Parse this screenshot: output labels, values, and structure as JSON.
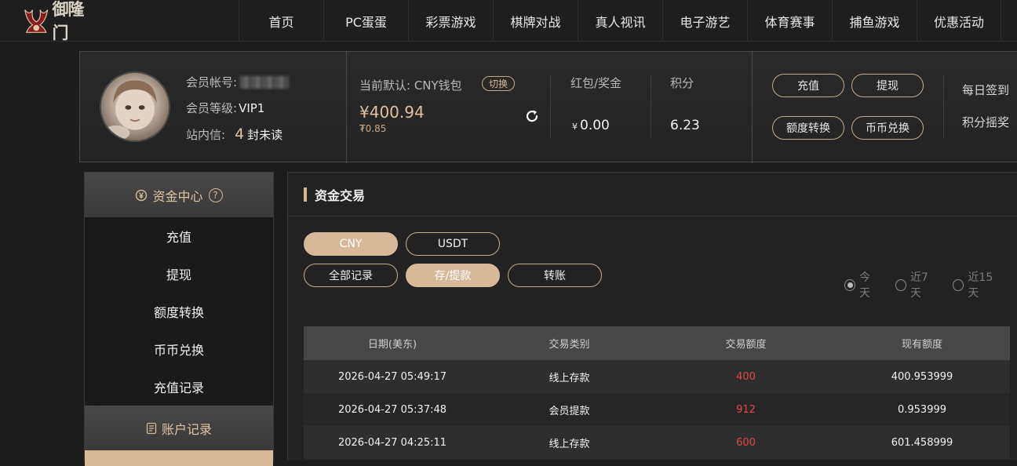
{
  "brand": {
    "name": "御隆门"
  },
  "nav": [
    "首页",
    "PC蛋蛋",
    "彩票游戏",
    "棋牌对战",
    "真人视讯",
    "电子游艺",
    "体育赛事",
    "捕鱼游戏",
    "优惠活动"
  ],
  "account": {
    "member_label": "会员帐号:",
    "level_label": "会员等级:",
    "level_value": "VIP1",
    "message_label": "站内信:",
    "message_count": "4",
    "message_unit": "封未读",
    "wallet_label": "当前默认: CNY钱包",
    "switch_label": "切换",
    "balance": "¥400.94",
    "balance_sub": "₮0.85",
    "bonus_label": "红包/奖金",
    "bonus_currency": "¥",
    "bonus_value": "0.00",
    "points_label": "积分",
    "points_value": "6.23",
    "buttons": {
      "deposit": "充值",
      "withdraw": "提现",
      "transfer": "额度转换",
      "exchange": "币币兑换"
    },
    "links": {
      "signin": "每日签到",
      "lottery": "积分摇奖"
    }
  },
  "sidebar": {
    "section1": "资金中心",
    "section1_help": "?",
    "items": [
      "充值",
      "提现",
      "额度转换",
      "币币兑换",
      "充值记录"
    ],
    "section2": "账户记录"
  },
  "main": {
    "title": "资金交易",
    "currency_tabs": [
      "CNY",
      "USDT"
    ],
    "type_tabs": [
      "全部记录",
      "存/提款",
      "转账"
    ],
    "ranges": [
      "今天",
      "近7天",
      "近15天"
    ],
    "columns": [
      "日期(美东)",
      "交易类别",
      "交易额度",
      "现有额度"
    ],
    "rows": [
      {
        "date": "2026-04-27 05:49:17",
        "type": "线上存款",
        "amount": "400",
        "balance": "400.953999"
      },
      {
        "date": "2026-04-27 05:37:48",
        "type": "会员提款",
        "amount": "912",
        "balance": "0.953999"
      },
      {
        "date": "2026-04-27 04:25:11",
        "type": "线上存款",
        "amount": "600",
        "balance": "601.458999"
      }
    ]
  },
  "colors": {
    "accent": "#d7b99a",
    "amount": "#e24848"
  }
}
